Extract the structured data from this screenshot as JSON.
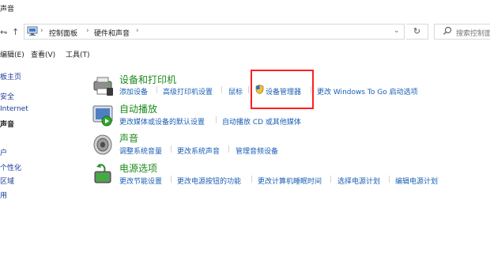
{
  "window": {
    "title": "声音"
  },
  "nav": {
    "back": "←",
    "forward": "→",
    "history": "⌄",
    "up": "↑"
  },
  "address": {
    "crumbs": [
      "控制面板",
      "硬件和声音"
    ],
    "separator": "›",
    "dropdown": "⌄",
    "refresh": "↻"
  },
  "search": {
    "placeholder": "搜索控制面"
  },
  "menu": [
    "编辑(E)",
    "查看(V)",
    "工具(T)"
  ],
  "left_nav": [
    {
      "label": "板主页",
      "current": false
    },
    {
      "label": "安全",
      "current": false
    },
    {
      "label": "Internet",
      "current": false
    },
    {
      "label": "声音",
      "current": true
    },
    {
      "label": "户",
      "current": false
    },
    {
      "label": "个性化",
      "current": false
    },
    {
      "label": "区域",
      "current": false
    },
    {
      "label": "用",
      "current": false
    }
  ],
  "categories": [
    {
      "title": "设备和打印机",
      "icon": "devices-printers-icon",
      "links": [
        "添加设备",
        "高级打印机设置",
        "鼠标",
        "设备管理器",
        "更改 Windows To Go 启动选项"
      ]
    },
    {
      "title": "自动播放",
      "icon": "autoplay-icon",
      "links": [
        "更改媒体或设备的默认设置",
        "自动播放 CD 或其他媒体"
      ]
    },
    {
      "title": "声音",
      "icon": "speaker-icon",
      "links": [
        "调整系统音量",
        "更改系统声音",
        "管理音频设备"
      ]
    },
    {
      "title": "电源选项",
      "icon": "power-options-icon",
      "links": [
        "更改节能设置",
        "更改电源按钮的功能",
        "更改计算机睡眠时间",
        "选择电源计划",
        "编辑电源计划"
      ]
    }
  ],
  "colors": {
    "category_title": "#1c8a1c",
    "link": "#1a5fb4",
    "highlight": "#ff1f1f"
  }
}
